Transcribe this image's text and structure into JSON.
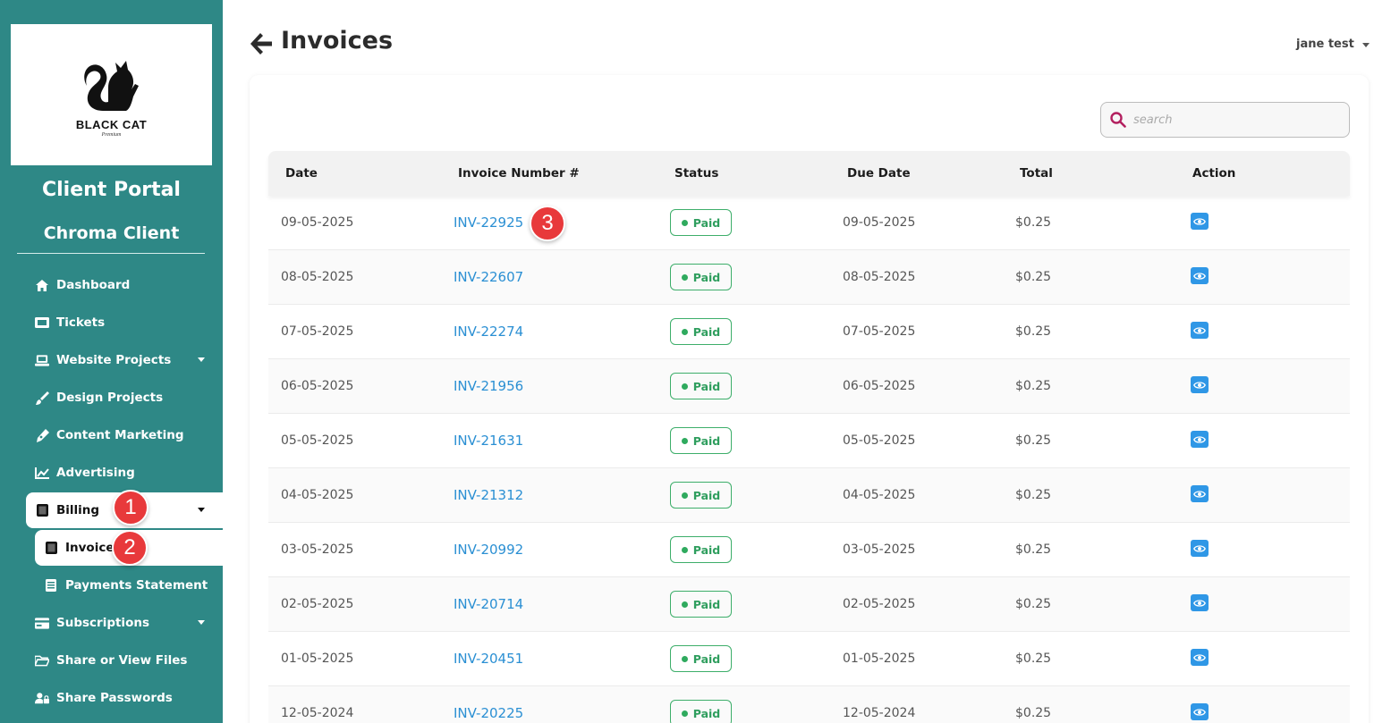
{
  "brand": {
    "logo_text": "BLACK CAT",
    "logo_subtext": "Premium",
    "portal_title": "Client Portal",
    "client_name": "Chroma Client"
  },
  "sidebar": {
    "items": [
      {
        "label": "Dashboard",
        "icon": "home-icon"
      },
      {
        "label": "Tickets",
        "icon": "ticket-icon"
      },
      {
        "label": "Website Projects",
        "icon": "laptop-icon"
      },
      {
        "label": "Design Projects",
        "icon": "brush-icon"
      },
      {
        "label": "Content Marketing",
        "icon": "pen-icon"
      },
      {
        "label": "Advertising",
        "icon": "chart-line-icon"
      },
      {
        "label": "Billing",
        "icon": "billing-icon"
      },
      {
        "label": "Invoices",
        "icon": "invoice-icon"
      },
      {
        "label": "Payments Statement",
        "icon": "statement-icon"
      },
      {
        "label": "Subscriptions",
        "icon": "card-icon"
      },
      {
        "label": "Share or View Files",
        "icon": "folder-icon"
      },
      {
        "label": "Share Passwords",
        "icon": "user-lock-icon"
      }
    ]
  },
  "header": {
    "title": "Invoices",
    "user_name": "jane test"
  },
  "search": {
    "placeholder": "search"
  },
  "table": {
    "columns": [
      "Date",
      "Invoice Number #",
      "Status",
      "Due Date",
      "Total",
      "Action"
    ],
    "rows": [
      {
        "date": "09-05-2025",
        "invoice": "INV-22925",
        "status": "Paid",
        "due": "09-05-2025",
        "total": "$0.25"
      },
      {
        "date": "08-05-2025",
        "invoice": "INV-22607",
        "status": "Paid",
        "due": "08-05-2025",
        "total": "$0.25"
      },
      {
        "date": "07-05-2025",
        "invoice": "INV-22274",
        "status": "Paid",
        "due": "07-05-2025",
        "total": "$0.25"
      },
      {
        "date": "06-05-2025",
        "invoice": "INV-21956",
        "status": "Paid",
        "due": "06-05-2025",
        "total": "$0.25"
      },
      {
        "date": "05-05-2025",
        "invoice": "INV-21631",
        "status": "Paid",
        "due": "05-05-2025",
        "total": "$0.25"
      },
      {
        "date": "04-05-2025",
        "invoice": "INV-21312",
        "status": "Paid",
        "due": "04-05-2025",
        "total": "$0.25"
      },
      {
        "date": "03-05-2025",
        "invoice": "INV-20992",
        "status": "Paid",
        "due": "03-05-2025",
        "total": "$0.25"
      },
      {
        "date": "02-05-2025",
        "invoice": "INV-20714",
        "status": "Paid",
        "due": "02-05-2025",
        "total": "$0.25"
      },
      {
        "date": "01-05-2025",
        "invoice": "INV-20451",
        "status": "Paid",
        "due": "01-05-2025",
        "total": "$0.25"
      },
      {
        "date": "12-05-2024",
        "invoice": "INV-20225",
        "status": "Paid",
        "due": "12-05-2024",
        "total": "$0.25"
      }
    ]
  },
  "annotations": [
    "1",
    "2",
    "3"
  ],
  "colors": {
    "sidebar_bg": "#2e8886",
    "link": "#2a8fd3",
    "paid": "#3dae6a",
    "action": "#2f97e6",
    "marker": "#e8393b"
  }
}
